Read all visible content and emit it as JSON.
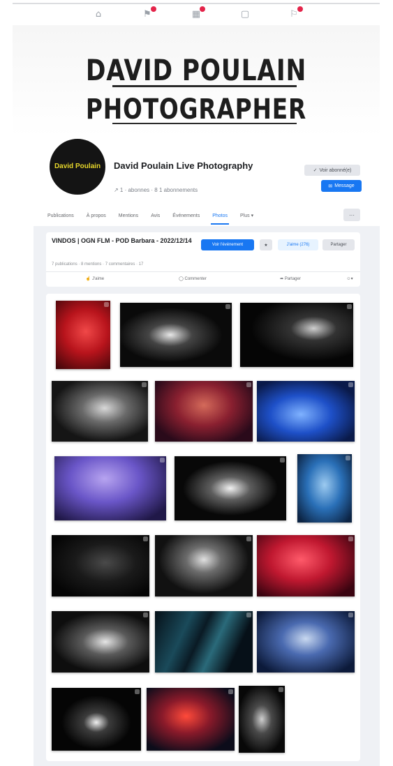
{
  "page": {
    "name": "David Poulain Live Photography",
    "stats": "↗ 1 · abonnes · 8 1 abonnements",
    "avatar_text": "David Poulain",
    "edit_button": "Voir abonné(e)",
    "message_button": "Message"
  },
  "cover": {
    "line1": "DAVID POULAIN",
    "line2": "PHOTOGRAPHER"
  },
  "topbar_icons": [
    "home-icon",
    "flag-icon",
    "store-icon",
    "group-icon",
    "bell-icon"
  ],
  "tabs": [
    "Publications",
    "À propos",
    "Mentions",
    "Avis",
    "Événements",
    "Photos",
    "Plus ▾"
  ],
  "active_tab": "Photos",
  "tab_more": "···",
  "album": {
    "title": "VINDOS | OGN FLM - POD Barbara - 2022/12/14",
    "primary_button": "Voir l'événement",
    "like_button": "J'aime (276)",
    "share_button": "Partager",
    "meta": "7 publications · 8 mentions · 7 commentaires · 17",
    "actions": [
      "J'aime",
      "Commenter",
      "Partager",
      "▾"
    ]
  },
  "photos": [
    {
      "alt": "singer-red"
    },
    {
      "alt": "stage-lights-bw"
    },
    {
      "alt": "dj-spotlight-bw"
    },
    {
      "alt": "performer-white-jacket"
    },
    {
      "alt": "performer-red-crowd"
    },
    {
      "alt": "performer-blue-stage"
    },
    {
      "alt": "dj-purple"
    },
    {
      "alt": "stage-beams-bw"
    },
    {
      "alt": "singer-blue"
    },
    {
      "alt": "dark-stage-bw"
    },
    {
      "alt": "singer-spotlight-bw"
    },
    {
      "alt": "red-lights-stage"
    },
    {
      "alt": "singer-closeup-bw"
    },
    {
      "alt": "blue-lasers"
    },
    {
      "alt": "performer-blue-light"
    },
    {
      "alt": "singer-beam-bw"
    },
    {
      "alt": "red-beams-crowd"
    },
    {
      "alt": "guitarist-bw"
    }
  ],
  "colors": {
    "accent": "#1877f2",
    "notification": "#e4244a",
    "content_bg": "#eff1f5"
  }
}
